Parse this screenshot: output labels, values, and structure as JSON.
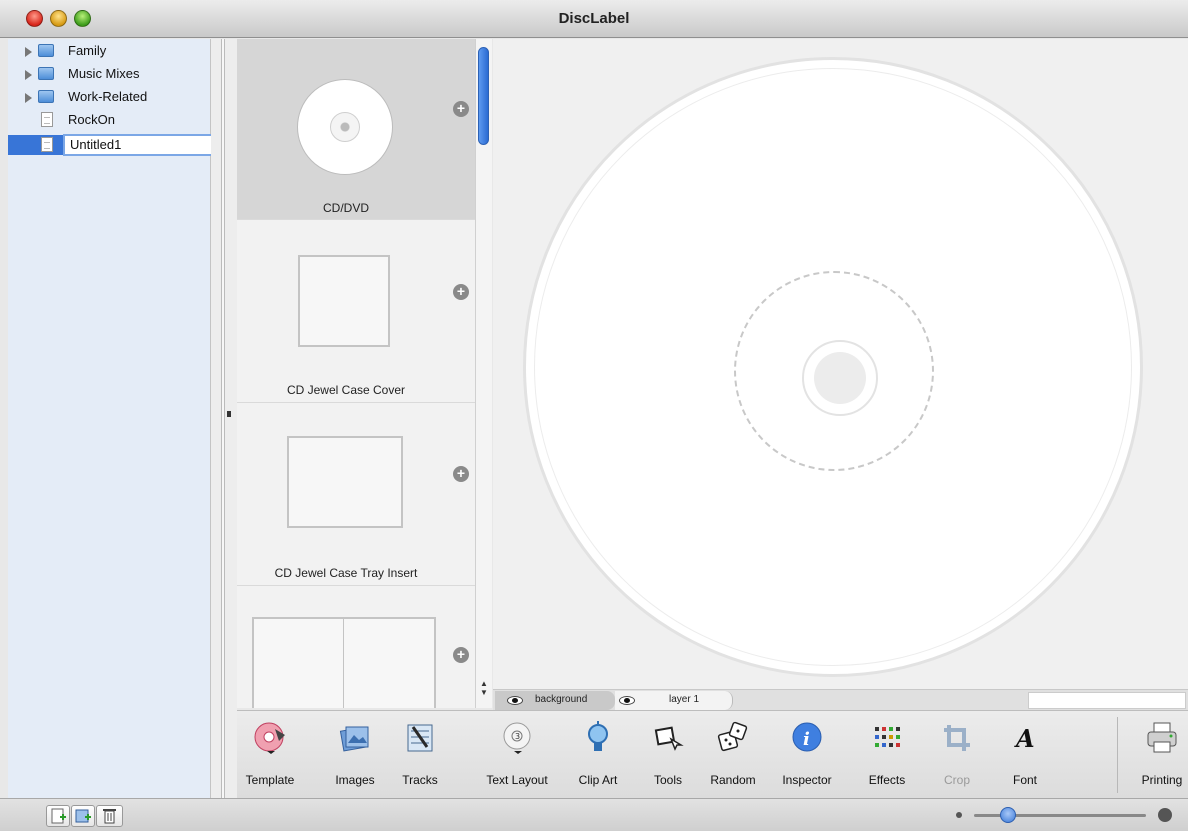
{
  "window": {
    "title": "DiscLabel"
  },
  "sidebar": {
    "items": [
      {
        "label": "Family",
        "type": "folder"
      },
      {
        "label": "Music Mixes",
        "type": "folder"
      },
      {
        "label": "Work-Related",
        "type": "folder"
      },
      {
        "label": "RockOn",
        "type": "document"
      },
      {
        "label": "Untitled1",
        "type": "document",
        "editing": true
      }
    ]
  },
  "templates": {
    "items": [
      {
        "label": "CD/DVD",
        "selected": true
      },
      {
        "label": "CD Jewel Case Cover",
        "selected": false
      },
      {
        "label": "CD Jewel Case Tray Insert",
        "selected": false
      },
      {
        "label": "",
        "selected": false
      }
    ]
  },
  "layers": {
    "background": "background",
    "layer1": "layer 1"
  },
  "toolbar": {
    "template": "Template",
    "images": "Images",
    "tracks": "Tracks",
    "text_layout": "Text Layout",
    "clip_art": "Clip Art",
    "tools": "Tools",
    "random": "Random",
    "inspector": "Inspector",
    "effects": "Effects",
    "crop": "Crop",
    "font": "Font",
    "printing": "Printing"
  },
  "icons": {
    "template": "template-disc-icon",
    "images": "images-icon",
    "tracks": "tracks-icon",
    "text_layout": "text-layout-icon",
    "clip_art": "lightbulb-icon",
    "tools": "lasso-icon",
    "random": "dice-icon",
    "inspector": "info-icon",
    "effects": "effects-icon",
    "crop": "crop-icon",
    "font": "font-icon",
    "printing": "printer-icon"
  },
  "colors": {
    "selection": "#3875d7",
    "accent": "#2b6bd2"
  },
  "zoom": {
    "level": 0.2
  }
}
